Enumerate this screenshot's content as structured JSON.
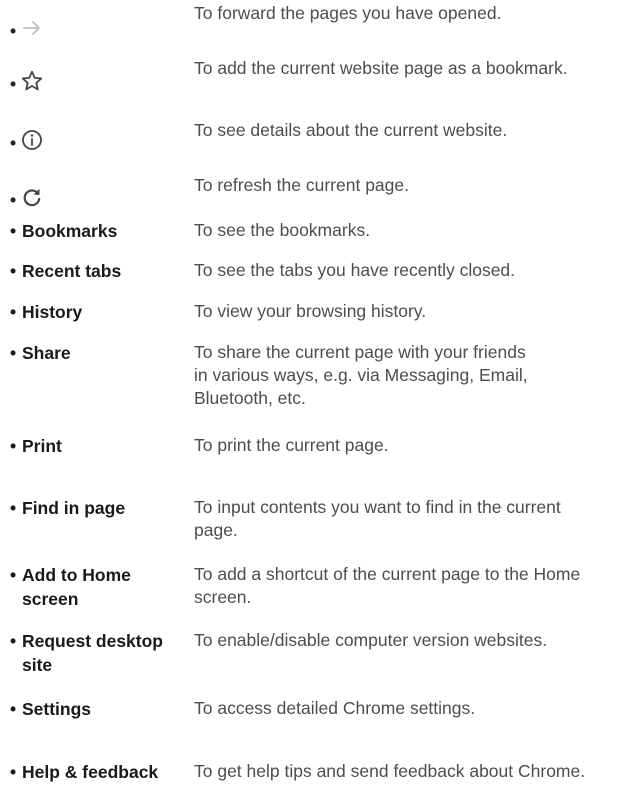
{
  "icon_items": [
    {
      "icon": "forward-arrow-icon",
      "desc": "To forward the pages you have opened."
    },
    {
      "icon": "star-icon",
      "desc": "To add the current website page as a bookmark."
    },
    {
      "icon": "info-icon",
      "desc": "To see details about the current website."
    },
    {
      "icon": "refresh-icon",
      "desc": "To refresh the current page."
    }
  ],
  "items": [
    {
      "term": "Bookmarks",
      "desc": "To see the bookmarks."
    },
    {
      "term": "Recent tabs",
      "desc": "To see the tabs you have recently closed."
    },
    {
      "term": "History",
      "desc": "To view your browsing history."
    },
    {
      "term": "Share",
      "desc": "To share the current page with your friends in various ways, e.g. via Messaging, Email, Bluetooth, etc."
    },
    {
      "term": "Print",
      "desc": "To print the current page."
    },
    {
      "term": "Find in page",
      "desc": "To input contents you want to find in the current page."
    },
    {
      "term_line1": "Add to Home",
      "term_line2": "screen",
      "desc": "To add a shortcut of the current page to the Home screen."
    },
    {
      "term_line1": "Request desktop",
      "term_line2": "site",
      "desc": "To enable/disable computer version websites."
    },
    {
      "term": "Settings",
      "desc": "To access detailed Chrome settings."
    },
    {
      "term": "Help & feedback",
      "desc": "To get help tips and send feedback about Chrome."
    }
  ],
  "colors": {
    "forward_icon": "#c6c6c6",
    "icon": "#444444"
  }
}
